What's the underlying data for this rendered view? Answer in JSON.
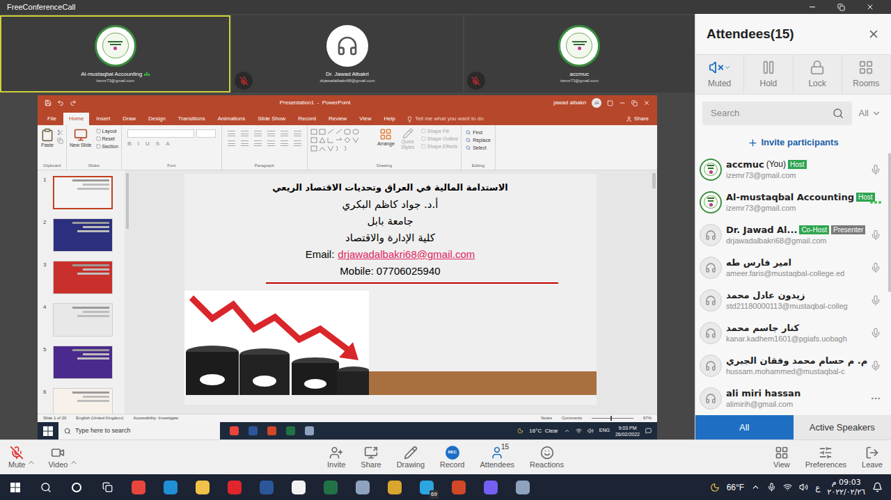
{
  "window": {
    "title": "FreeConferenceCall"
  },
  "video_tiles": [
    {
      "name": "Al-mustaqbal Accounting",
      "email": "izemr73@gmail.com",
      "kind": "logo",
      "selected": true,
      "muted": false,
      "speaking": true
    },
    {
      "name": "Dr. Jawad Albakri",
      "email": "drjawadalbakri68@gmail.com",
      "kind": "headset",
      "selected": false,
      "muted": true,
      "speaking": false
    },
    {
      "name": "accmuc",
      "email": "izemr73@gmail.com",
      "kind": "logo",
      "selected": false,
      "muted": true,
      "speaking": false
    }
  ],
  "powerpoint": {
    "title": "Presentation1  -  PowerPoint",
    "user": "jawad albakri",
    "user_initials": "JA",
    "tabs": [
      {
        "label": "File",
        "selected": false
      },
      {
        "label": "Home",
        "selected": true
      },
      {
        "label": "Insert",
        "selected": false
      },
      {
        "label": "Draw",
        "selected": false
      },
      {
        "label": "Design",
        "selected": false
      },
      {
        "label": "Transitions",
        "selected": false
      },
      {
        "label": "Animations",
        "selected": false
      },
      {
        "label": "Slide Show",
        "selected": false
      },
      {
        "label": "Record",
        "selected": false
      },
      {
        "label": "Review",
        "selected": false
      },
      {
        "label": "View",
        "selected": false
      },
      {
        "label": "Help",
        "selected": false
      }
    ],
    "tell_me": "Tell me what you want to do",
    "share": "Share",
    "ribbon": [
      {
        "label": "Clipboard",
        "kind": "clipboard",
        "items": [
          {
            "label": "Paste",
            "disabled": false
          }
        ]
      },
      {
        "label": "Slides",
        "kind": "slides",
        "items": [
          {
            "label": "New Slide",
            "disabled": false
          },
          {
            "label": "Layout",
            "disabled": false
          },
          {
            "label": "Reset",
            "disabled": false
          },
          {
            "label": "Section",
            "disabled": false
          }
        ]
      },
      {
        "label": "Font",
        "kind": "font",
        "items": [
          {
            "label": "B",
            "disabled": true
          },
          {
            "label": "I",
            "disabled": true
          },
          {
            "label": "U",
            "disabled": true
          },
          {
            "label": "S",
            "disabled": true
          },
          {
            "label": "A",
            "disabled": true
          }
        ]
      },
      {
        "label": "Paragraph",
        "kind": "paragraph",
        "items": []
      },
      {
        "label": "Drawing",
        "kind": "drawing",
        "items": [
          {
            "label": "Arrange",
            "disabled": false
          },
          {
            "label": "Quick Styles",
            "disabled": true
          },
          {
            "label": "Shape Fill",
            "disabled": true
          },
          {
            "label": "Shape Outline",
            "disabled": true
          },
          {
            "label": "Shape Effects",
            "disabled": true
          }
        ]
      },
      {
        "label": "Editing",
        "kind": "editing",
        "items": [
          {
            "label": "Find",
            "disabled": false
          },
          {
            "label": "Replace",
            "disabled": false
          },
          {
            "label": "Select",
            "disabled": false
          }
        ]
      }
    ],
    "thumbnails": [
      {
        "number": "1",
        "selected": true,
        "color": "#f4f4f4"
      },
      {
        "number": "2",
        "selected": false,
        "color": "#2b2f7d"
      },
      {
        "number": "3",
        "selected": false,
        "color": "#c9302c"
      },
      {
        "number": "4",
        "selected": false,
        "color": "#e8e8e8"
      },
      {
        "number": "5",
        "selected": false,
        "color": "#4a2a8c"
      },
      {
        "number": "6",
        "selected": false,
        "color": "#f7f1ea"
      }
    ],
    "slide": {
      "title": "الاستدامة المالية في العراق وتحديات الاقتصاد الريعي",
      "lines": [
        "أ.د. جواد كاظم البكري",
        "جامعة بابل",
        "كلية الإدارة والاقتصاد"
      ],
      "email_label": "Email:",
      "email": "drjawadalbakri68@gmail.com",
      "mobile": "Mobile: 07706025940"
    },
    "status_bar": {
      "slide": "Slide 1 of 20",
      "language": "English (United Kingdom)",
      "accessibility": "Accessibility: Investigate",
      "notes": "Notes",
      "comments": "Comments",
      "zoom": "67%",
      "zoom_level": 0.45
    },
    "taskbar": {
      "search_placeholder": "Type here to search",
      "apps": [
        {
          "color": "#e8453c"
        },
        {
          "color": "#2b579a"
        },
        {
          "color": "#d24726"
        },
        {
          "color": "#217346"
        },
        {
          "color": "#8fa3bf"
        }
      ],
      "weather": "16°C  Clear",
      "language": "ENG",
      "time": "9:03 PM",
      "date": "26/02/2022"
    }
  },
  "attendees_panel": {
    "title": "Attendees(15)",
    "tools": [
      {
        "label": "Muted",
        "kind": "muted",
        "selected": true
      },
      {
        "label": "Hold",
        "kind": "hold",
        "selected": false
      },
      {
        "label": "Lock",
        "kind": "lock",
        "selected": false
      },
      {
        "label": "Rooms",
        "kind": "rooms",
        "selected": false
      }
    ],
    "search_placeholder": "Search",
    "filter": "All",
    "invite": "Invite participants",
    "attendees": [
      {
        "name": "accmuc",
        "suffix": "(You)",
        "badges": [
          {
            "label": "Host",
            "color": "#2ea44f"
          }
        ],
        "email": "izemr73@gmail.com",
        "kind": "logo",
        "audio": "mic"
      },
      {
        "name": "Al-mustaqbal Accounting",
        "suffix": "",
        "badges": [
          {
            "label": "Host",
            "color": "#2ea44f"
          }
        ],
        "email": "izemr73@gmail.com",
        "kind": "logo",
        "audio": "speaking"
      },
      {
        "name": "Dr. Jawad Al...",
        "suffix": "",
        "badges": [
          {
            "label": "Co-Host",
            "color": "#2ea44f"
          },
          {
            "label": "Presenter",
            "color": "#7a7a7a"
          }
        ],
        "email": "drjawadalbakri68@gmail.com",
        "kind": "headset",
        "audio": "mic"
      },
      {
        "name": "امير فارس طه",
        "suffix": "",
        "badges": [],
        "email": "ameer.faris@mustaqbal-college.ed",
        "kind": "headset",
        "audio": "mic"
      },
      {
        "name": "زيدون عادل محمد",
        "suffix": "",
        "badges": [],
        "email": "std21180000113@mustaqbal-colleg",
        "kind": "headset",
        "audio": "mic"
      },
      {
        "name": "كنار جاسم محمد",
        "suffix": "",
        "badges": [],
        "email": "kanar.kadhem1601@pgiafs.uobagh",
        "kind": "headset",
        "audio": "mic"
      },
      {
        "name": "م. م حسام محمد وفقان الجبري",
        "suffix": "",
        "badges": [],
        "email": "hussam.mohammed@mustaqbal-c",
        "kind": "headset",
        "audio": "mic"
      },
      {
        "name": "ali miri hassan",
        "suffix": "",
        "badges": [],
        "email": "alimirih@gmail.com",
        "kind": "headset",
        "audio": "more"
      }
    ],
    "tabs": [
      {
        "label": "All",
        "selected": true
      },
      {
        "label": "Active Speakers",
        "selected": false
      }
    ]
  },
  "bottom_toolbar": {
    "left": [
      {
        "label": "Mute",
        "kind": "mute",
        "muted": true
      },
      {
        "label": "Video",
        "kind": "video",
        "muted": false
      }
    ],
    "center": [
      {
        "label": "Invite",
        "kind": "invite",
        "badge": ""
      },
      {
        "label": "Share",
        "kind": "share",
        "badge": ""
      },
      {
        "label": "Drawing",
        "kind": "drawing",
        "badge": ""
      },
      {
        "label": "Record",
        "kind": "record",
        "badge": "REC"
      },
      {
        "label": "Attendees",
        "kind": "attendees",
        "badge": "15"
      },
      {
        "label": "Reactions",
        "kind": "reactions",
        "badge": ""
      }
    ],
    "right": [
      {
        "label": "View",
        "kind": "view"
      },
      {
        "label": "Preferences",
        "kind": "preferences"
      },
      {
        "label": "Leave",
        "kind": "leave"
      }
    ]
  },
  "os_taskbar": {
    "apps": [
      {
        "color": "#e8453c",
        "badge": ""
      },
      {
        "color": "#1f8fd6",
        "badge": ""
      },
      {
        "color": "#f1c24a",
        "badge": ""
      },
      {
        "color": "#e0262c",
        "badge": ""
      },
      {
        "color": "#2b579a",
        "badge": ""
      },
      {
        "color": "#f2f2f2",
        "badge": ""
      },
      {
        "color": "#217346",
        "badge": ""
      },
      {
        "color": "#8fa3bf",
        "badge": ""
      },
      {
        "color": "#d9a62e",
        "badge": ""
      },
      {
        "color": "#2ca5e0",
        "badge": "69"
      },
      {
        "color": "#d24726",
        "badge": ""
      },
      {
        "color": "#7360f2",
        "badge": ""
      },
      {
        "color": "#8fa3bf",
        "badge": ""
      }
    ],
    "weather": "66°F",
    "language": "ع",
    "time": "09:03 م",
    "date": "٢٠٢٢/٠٢/٢٦"
  }
}
